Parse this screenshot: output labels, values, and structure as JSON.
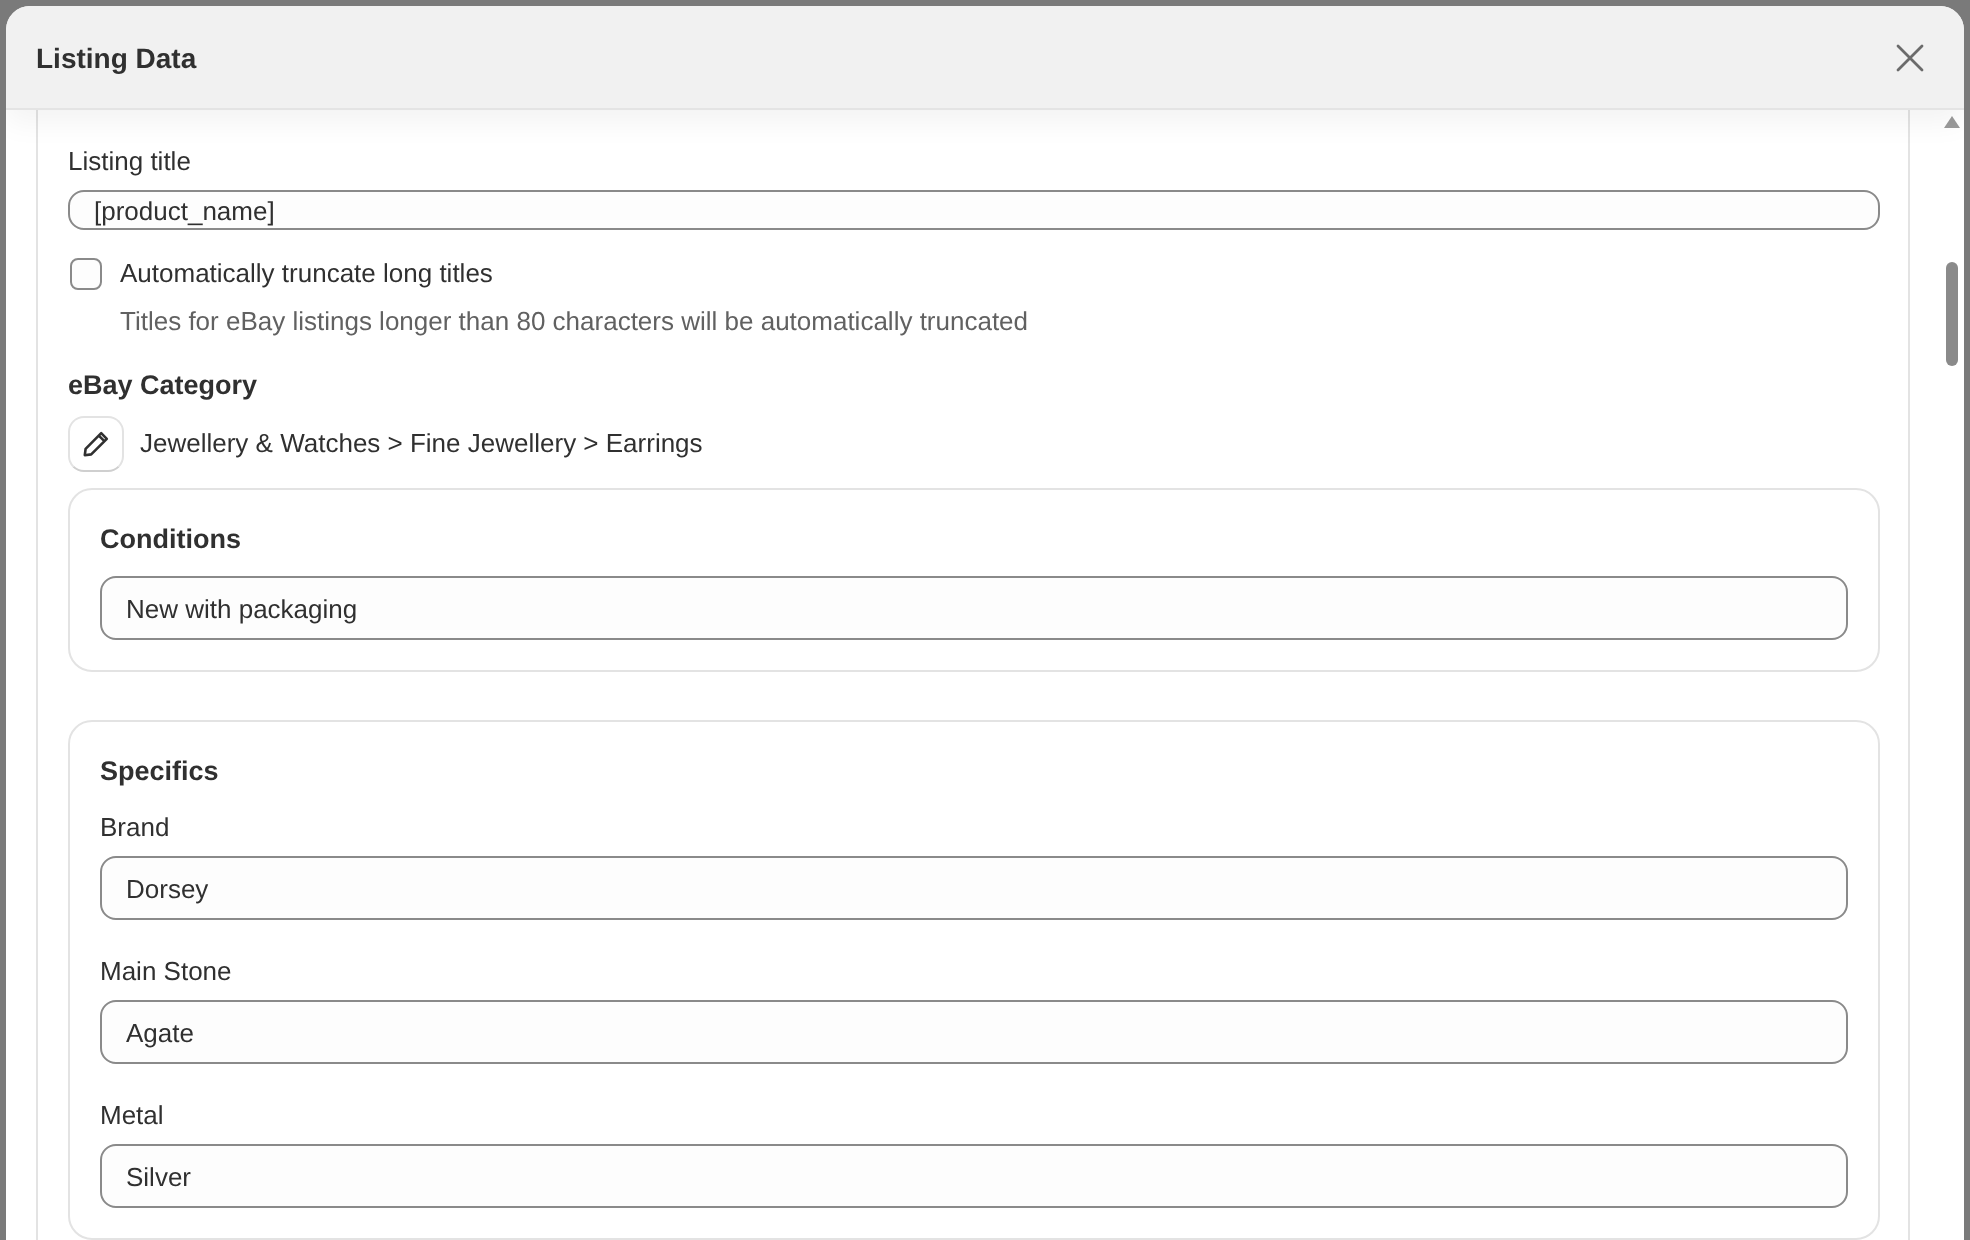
{
  "dialog": {
    "title": "Listing Data"
  },
  "listing_title": {
    "label": "Listing title",
    "value": "[product_name]"
  },
  "truncate_option": {
    "label": "Automatically truncate long titles",
    "checked": false,
    "hint": "Titles for eBay listings longer than 80 characters will be automatically truncated"
  },
  "category": {
    "heading": "eBay Category",
    "path": "Jewellery & Watches > Fine Jewellery > Earrings"
  },
  "conditions": {
    "heading": "Conditions",
    "value": "New with packaging"
  },
  "specifics": {
    "heading": "Specifics",
    "fields": [
      {
        "label": "Brand",
        "value": "Dorsey"
      },
      {
        "label": "Main Stone",
        "value": "Agate"
      },
      {
        "label": "Metal",
        "value": "Silver"
      }
    ]
  }
}
